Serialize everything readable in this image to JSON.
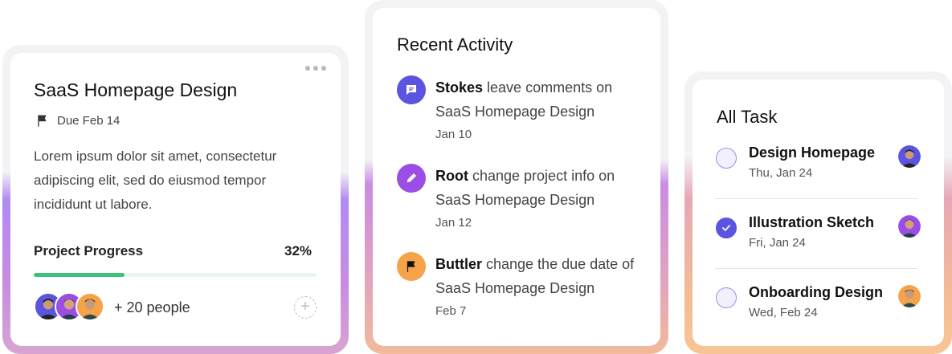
{
  "project_card": {
    "title": "SaaS Homepage Design",
    "due": "Due Feb 14",
    "description": "Lorem ipsum dolor sit amet, consectetur adipiscing elit, sed do eiusmod tempor incididunt ut labore.",
    "progress_label": "Project Progress",
    "progress_text": "32%",
    "progress_value": 0.32,
    "people": "+ 20 people",
    "add_symbol": "+"
  },
  "recent_activity": {
    "title": "Recent Activity",
    "items": [
      {
        "user": "Stokes",
        "text": " leave comments on SaaS Homepage Design",
        "date": "Jan 10",
        "icon": "comment-icon",
        "color": "#5b54e0"
      },
      {
        "user": "Root",
        "text": " change project info on SaaS Homepage Design",
        "date": "Jan 12",
        "icon": "pencil-icon",
        "color": "#9b4ee6"
      },
      {
        "user": "Buttler",
        "text": " change the due date of SaaS Homepage Design",
        "date": "Feb 7",
        "icon": "flag-icon",
        "color": "#f5a34a"
      }
    ]
  },
  "all_task": {
    "title": "All Task",
    "tasks": [
      {
        "name": "Design Homepage",
        "date": "Thu, Jan 24",
        "done": false
      },
      {
        "name": "Illustration Sketch",
        "date": "Fri, Jan 24",
        "done": true
      },
      {
        "name": "Onboarding Design",
        "date": "Wed, Feb 24",
        "done": false
      }
    ]
  },
  "colors": {
    "accent": "#5b54e0",
    "progress": "#3cc27a",
    "progress_track": "#e9f6ef"
  }
}
